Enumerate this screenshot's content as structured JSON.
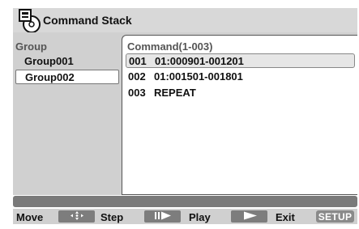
{
  "header": {
    "title": "Command Stack",
    "icon": "disc-with-clipboard-icon"
  },
  "groups": {
    "header": "Group",
    "items": [
      {
        "label": "Group001",
        "selected": false
      },
      {
        "label": "Group002",
        "selected": true
      }
    ]
  },
  "commands": {
    "header": "Command(1-003)",
    "rows": [
      {
        "num": "001",
        "text": "01:000901-001201",
        "selected": true
      },
      {
        "num": "002",
        "text": "01:001501-001801",
        "selected": false
      },
      {
        "num": "003",
        "text": "REPEAT",
        "selected": false
      }
    ]
  },
  "footer": {
    "move": "Move",
    "step": "Step",
    "play": "Play",
    "exit": "Exit",
    "setup": "SETUP",
    "icons": {
      "move": "four-way-arrow-icon",
      "step": "step-forward-icon",
      "play": "play-icon"
    }
  },
  "colors": {
    "panel_background": "#d0d0d0",
    "button_gray": "#7d7d7d",
    "status_bar": "#7a7a7a"
  }
}
